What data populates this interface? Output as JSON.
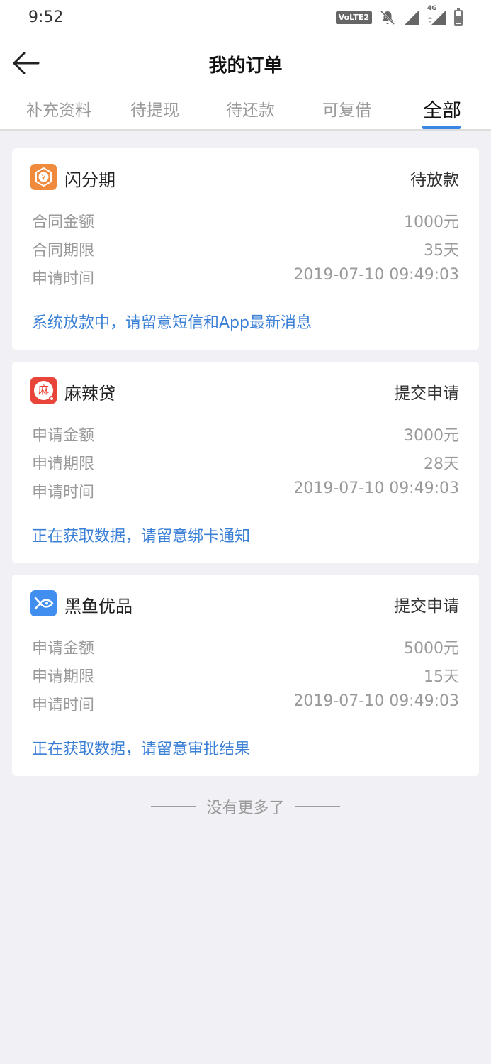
{
  "status_bar": {
    "time": "9:52",
    "volte_label": "VoLTE2",
    "network_label": "4G",
    "icons": [
      "volte-icon",
      "mute-bell-icon",
      "signal-icon",
      "signal-4g-icon",
      "battery-icon"
    ]
  },
  "header": {
    "title": "我的订单",
    "back_icon": "arrow-left-icon"
  },
  "tabs": [
    {
      "label": "补充资料",
      "active": false
    },
    {
      "label": "待提现",
      "active": false
    },
    {
      "label": "待还款",
      "active": false
    },
    {
      "label": "可复借",
      "active": false
    },
    {
      "label": "全部",
      "active": true
    }
  ],
  "colors": {
    "accent": "#3a86e6",
    "notice_text": "#3a7fd6",
    "page_bg": "#f1f0f4"
  },
  "orders": [
    {
      "app_name": "闪分期",
      "logo_icon": "shanfenqi-logo-icon",
      "logo_color": "#f08a3c",
      "status": "待放款",
      "rows": [
        {
          "label": "合同金额",
          "value": "1000元"
        },
        {
          "label": "合同期限",
          "value": "35天"
        },
        {
          "label": "申请时间",
          "value": "2019-07-10 09:49:03"
        }
      ],
      "notice": "系统放款中，请留意短信和App最新消息"
    },
    {
      "app_name": "麻辣贷",
      "logo_icon": "malaidai-logo-icon",
      "logo_color": "#e8443a",
      "logo_char": "麻",
      "status": "提交申请",
      "rows": [
        {
          "label": "申请金额",
          "value": "3000元"
        },
        {
          "label": "申请期限",
          "value": "28天"
        },
        {
          "label": "申请时间",
          "value": "2019-07-10 09:49:03"
        }
      ],
      "notice": "正在获取数据，请留意绑卡通知"
    },
    {
      "app_name": "黑鱼优品",
      "logo_icon": "heiyu-logo-icon",
      "logo_color": "#3f8ef0",
      "status": "提交申请",
      "rows": [
        {
          "label": "申请金额",
          "value": "5000元"
        },
        {
          "label": "申请期限",
          "value": "15天"
        },
        {
          "label": "申请时间",
          "value": "2019-07-10 09:49:03"
        }
      ],
      "notice": "正在获取数据，请留意审批结果"
    }
  ],
  "footer": {
    "end_text": "没有更多了"
  }
}
